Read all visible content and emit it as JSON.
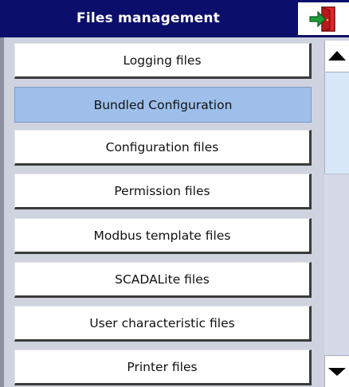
{
  "header": {
    "title": "Files management",
    "exit_icon": "exit-door-icon"
  },
  "file_list": {
    "selected_index": 1,
    "items": [
      {
        "label": "Logging files"
      },
      {
        "label": "Bundled Configuration"
      },
      {
        "label": "Configuration files"
      },
      {
        "label": "Permission files"
      },
      {
        "label": "Modbus template files"
      },
      {
        "label": "SCADALite files"
      },
      {
        "label": "User characteristic files"
      },
      {
        "label": "Printer files"
      }
    ]
  },
  "scrollbar": {
    "up_icon": "triangle-up-icon",
    "down_icon": "triangle-down-icon"
  },
  "colors": {
    "header_bg": "#0c0e6b",
    "selected_bg": "#9ebfea",
    "content_bg": "#cfd3e0",
    "exit_icon_red": "#e3262b",
    "exit_icon_green": "#1f9d3a"
  }
}
